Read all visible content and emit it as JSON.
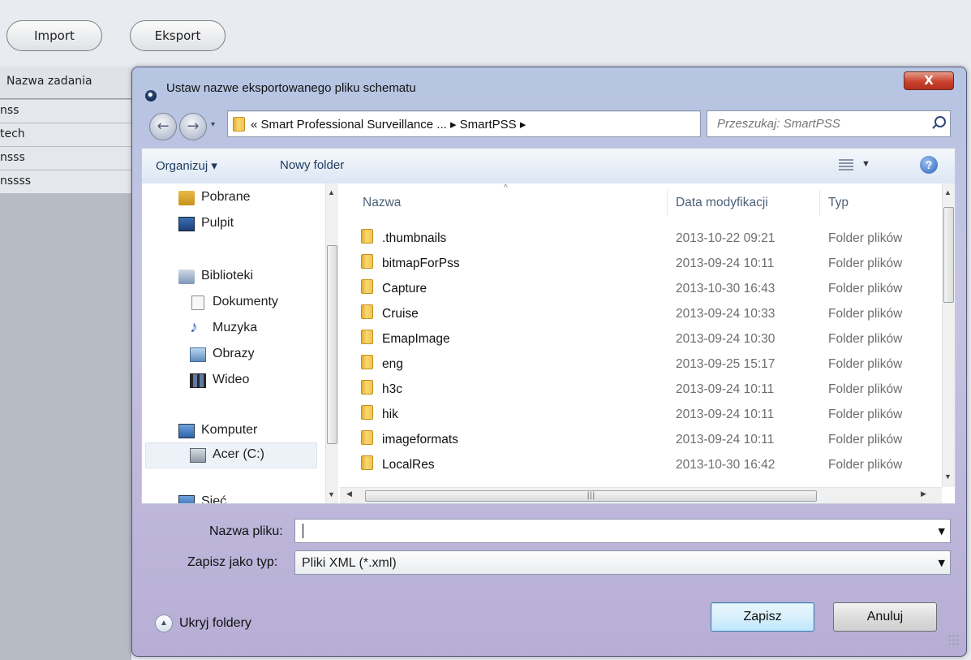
{
  "app": {
    "import_label": "Import",
    "export_label": "Eksport",
    "task_header": "Nazwa zadania",
    "tasks": [
      "nss",
      "tech",
      "nsss",
      "nssss"
    ]
  },
  "dialog": {
    "title": "Ustaw nazwe eksportowanego pliku schematu",
    "close_label": "X",
    "address": {
      "path": "« Smart Professional Surveillance ...  ▸  SmartPSS  ▸"
    },
    "search_placeholder": "Przeszukaj: SmartPSS",
    "commands": {
      "organize": "Organizuj ▾",
      "new_folder": "Nowy folder",
      "help": "?"
    },
    "nav_items": [
      "Pobrane",
      "Pulpit",
      "Biblioteki",
      "Dokumenty",
      "Muzyka",
      "Obrazy",
      "Wideo",
      "Komputer",
      "Acer (C:)",
      "Sieć"
    ],
    "columns": {
      "name": "Nazwa",
      "date": "Data modyfikacji",
      "type": "Typ"
    },
    "files": [
      {
        "name": ".thumbnails",
        "date": "2013-10-22 09:21",
        "type": "Folder plików"
      },
      {
        "name": "bitmapForPss",
        "date": "2013-09-24 10:11",
        "type": "Folder plików"
      },
      {
        "name": "Capture",
        "date": "2013-10-30 16:43",
        "type": "Folder plików"
      },
      {
        "name": "Cruise",
        "date": "2013-09-24 10:33",
        "type": "Folder plików"
      },
      {
        "name": "EmapImage",
        "date": "2013-09-24 10:30",
        "type": "Folder plików"
      },
      {
        "name": "eng",
        "date": "2013-09-25 15:17",
        "type": "Folder plików"
      },
      {
        "name": "h3c",
        "date": "2013-09-24 10:11",
        "type": "Folder plików"
      },
      {
        "name": "hik",
        "date": "2013-09-24 10:11",
        "type": "Folder plików"
      },
      {
        "name": "imageformats",
        "date": "2013-09-24 10:11",
        "type": "Folder plików"
      },
      {
        "name": "LocalRes",
        "date": "2013-10-30 16:42",
        "type": "Folder plików"
      }
    ],
    "form": {
      "filename_label": "Nazwa pliku:",
      "filename_value": "",
      "savetype_label": "Zapisz jako typ:",
      "savetype_value": "Pliki XML (*.xml)"
    },
    "hide_folders_label": "Ukryj foldery",
    "save_label": "Zapisz",
    "cancel_label": "Anuluj"
  }
}
